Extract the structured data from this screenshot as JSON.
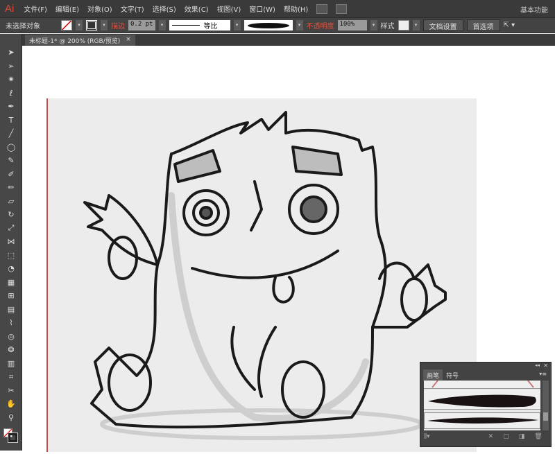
{
  "app": {
    "logo": "Ai",
    "workspace": "基本功能"
  },
  "menu": [
    "文件(F)",
    "编辑(E)",
    "对象(O)",
    "文字(T)",
    "选择(S)",
    "效果(C)",
    "视图(V)",
    "窗口(W)",
    "帮助(H)"
  ],
  "control": {
    "selection": "未选择对象",
    "stroke_label": "描边",
    "stroke_value": "0.2 pt",
    "stroke_profile": "等比",
    "opacity_label": "不透明度",
    "opacity_value": "100%",
    "style_label": "样式",
    "doc_setup": "文档设置",
    "preferences": "首选项"
  },
  "document_tab": {
    "title": "未标题-1* @ 200% (RGB/预览)",
    "close": "×"
  },
  "tools": [
    "selection",
    "direct-selection",
    "magic-wand",
    "lasso",
    "pen",
    "type",
    "line",
    "ellipse",
    "paintbrush",
    "pencil",
    "blob-brush",
    "eraser",
    "rotate",
    "scale",
    "width",
    "free-transform",
    "shape-builder",
    "perspective",
    "mesh",
    "gradient",
    "eyedropper",
    "blend",
    "symbol-sprayer",
    "column-graph",
    "artboard",
    "slice",
    "hand",
    "zoom"
  ],
  "brush_panel": {
    "tabs": [
      "画笔",
      "符号"
    ],
    "active_tab": "画笔"
  },
  "colors": {
    "accent": "#e0483a",
    "artboard_edge": "#c0504d"
  }
}
